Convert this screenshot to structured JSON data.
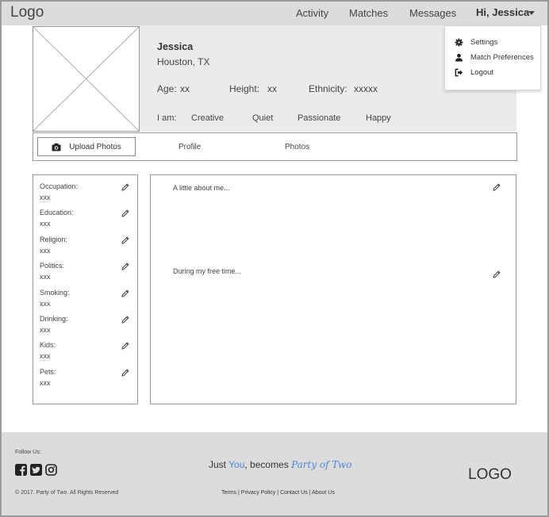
{
  "header": {
    "logo": "Logo",
    "nav": [
      "Activity",
      "Matches",
      "Messages"
    ],
    "user_greeting": "Hi, Jessica"
  },
  "dropdown": {
    "items": [
      {
        "label": "Settings",
        "icon": "gear-icon"
      },
      {
        "label": "Match Preferences",
        "icon": "user-icon"
      },
      {
        "label": "Logout",
        "icon": "logout-icon"
      }
    ]
  },
  "profile": {
    "name": "Jessica",
    "location": "Houston, TX",
    "age_label": "Age:",
    "age_value": "xx",
    "height_label": "Height:",
    "height_value": "xx",
    "ethnicity_label": "Ethnicity:",
    "ethnicity_value": "xxxxx",
    "iam_label": "I am:",
    "traits": [
      "Creative",
      "Quiet",
      "Passionate",
      "Happy"
    ]
  },
  "tabs": {
    "upload_label": "Upload Photos",
    "profile_label": "Profile",
    "photos_label": "Photos"
  },
  "details": [
    {
      "label": "Occupation:",
      "value": "xxx"
    },
    {
      "label": "Education:",
      "value": "xxx"
    },
    {
      "label": "Religion:",
      "value": "xxx"
    },
    {
      "label": "Politics:",
      "value": "xxx"
    },
    {
      "label": "Smoking:",
      "value": "xxx"
    },
    {
      "label": "Drinking:",
      "value": "xxx"
    },
    {
      "label": "Kids:",
      "value": "xxx"
    },
    {
      "label": "Pets:",
      "value": "xxx"
    }
  ],
  "about": {
    "about_me": "A little about me...",
    "free_time": "During my free time..."
  },
  "footer": {
    "follow_us": "Follow Us:",
    "copyright": "© 2017. Party of Two. All Rights Reserved",
    "tagline_pre": "Just ",
    "tagline_you": "You",
    "tagline_mid": ", becomes ",
    "tagline_brand": "Party of Two",
    "links": [
      "Terms",
      "Privacy Policy",
      "Contact Us",
      "About Us"
    ],
    "logo": "LOGO"
  },
  "colors": {
    "accent": "#4a86d9",
    "header_bg": "#dcdcdc",
    "profile_bg": "#ebebeb"
  }
}
